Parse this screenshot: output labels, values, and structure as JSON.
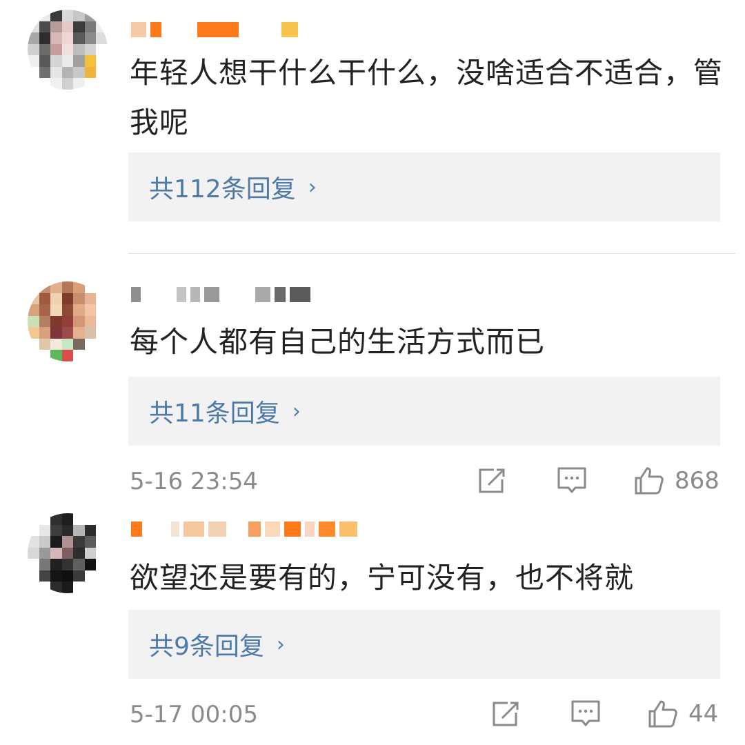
{
  "comments": [
    {
      "text": "年轻人想干什么干什么，没啥适合不适合，管我呢",
      "reply_label": "共112条回复",
      "reply_chevron": "›"
    },
    {
      "text": "每个人都有自己的生活方式而已",
      "reply_label": "共11条回复",
      "reply_chevron": "›",
      "timestamp": "5-16 23:54",
      "likes": "868"
    },
    {
      "text": "欲望还是要有的，宁可没有，也不将就",
      "reply_label": "共9条回复",
      "reply_chevron": "›",
      "timestamp": "5-17 00:05",
      "likes": "44"
    }
  ],
  "icons": {
    "share": "share-icon",
    "comment": "comment-icon",
    "like": "thumbs-up-icon"
  },
  "colors": {
    "link": "#4d7aa8",
    "meta": "#8a8a8a",
    "reply_bg": "#f2f2f2"
  }
}
